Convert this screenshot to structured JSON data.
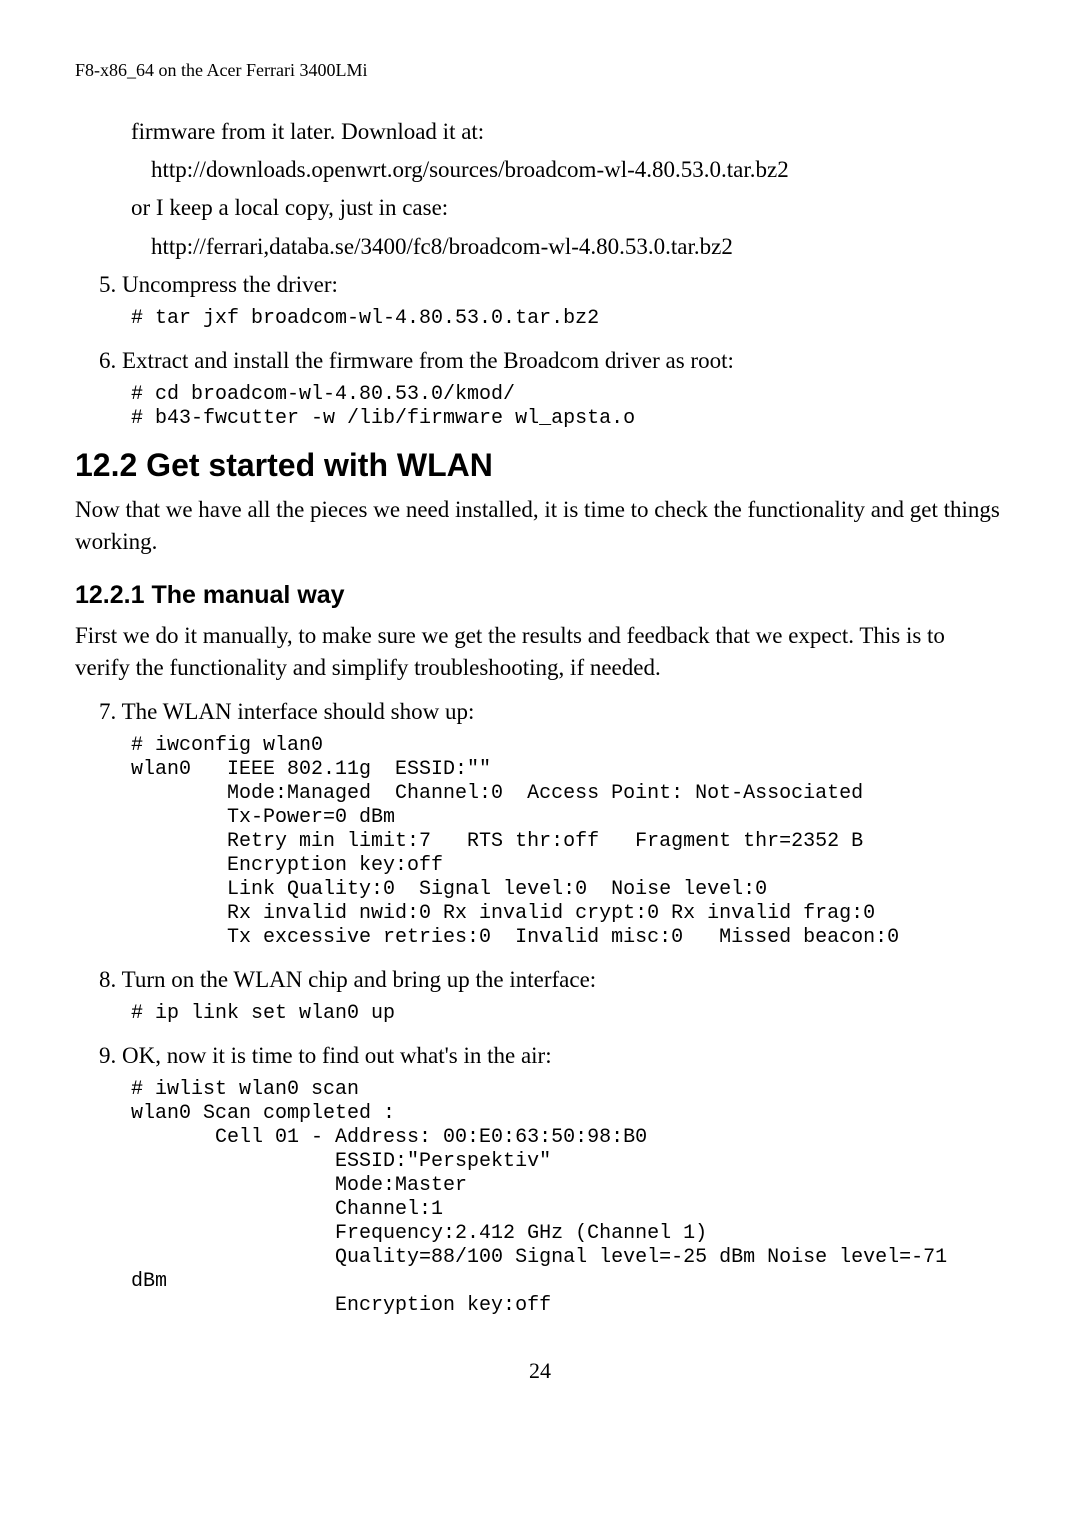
{
  "header": "F8-x86_64 on the Acer Ferrari 3400LMi",
  "p1": "firmware from it later. Download it at:",
  "url1": "http://downloads.openwrt.org/sources/broadcom-wl-4.80.53.0.tar.bz2",
  "p2": "or I keep a local copy, just in case:",
  "url2": "http://ferrari,databa.se/3400/fc8/broadcom-wl-4.80.53.0.tar.bz2",
  "li5": "5.  Uncompress the driver:",
  "code5": "# tar jxf broadcom-wl-4.80.53.0.tar.bz2",
  "li6": "6.  Extract and install the firmware from the Broadcom driver as root:",
  "code6": "# cd broadcom-wl-4.80.53.0/kmod/\n# b43-fwcutter -w /lib/firmware wl_apsta.o",
  "h12_2": " 12.2 Get started with WLAN",
  "p3": "Now that we have all the pieces we need installed, it is time to check the functionality and get things working.",
  "h12_2_1": " 12.2.1 The manual way",
  "p4": "First we do it manually, to make sure we get the results and feedback that we expect. This is to verify the functionality and simplify troubleshooting, if needed.",
  "li7": "7.  The WLAN interface should show up:",
  "code7": "# iwconfig wlan0\nwlan0   IEEE 802.11g  ESSID:\"\"\n        Mode:Managed  Channel:0  Access Point: Not-Associated\n        Tx-Power=0 dBm\n        Retry min limit:7   RTS thr:off   Fragment thr=2352 B\n        Encryption key:off\n        Link Quality:0  Signal level:0  Noise level:0\n        Rx invalid nwid:0 Rx invalid crypt:0 Rx invalid frag:0\n        Tx excessive retries:0  Invalid misc:0   Missed beacon:0",
  "li8": "8.  Turn on the WLAN chip and bring up the interface:",
  "code8": "# ip link set wlan0 up",
  "li9": "9.  OK, now it is time to find out what's in the air:",
  "code9": "# iwlist wlan0 scan\nwlan0 Scan completed :\n       Cell 01 - Address: 00:E0:63:50:98:B0\n                 ESSID:\"Perspektiv\"\n                 Mode:Master\n                 Channel:1\n                 Frequency:2.412 GHz (Channel 1)\n                 Quality=88/100 Signal level=-25 dBm Noise level=-71\ndBm\n                 Encryption key:off",
  "page_number": "24"
}
